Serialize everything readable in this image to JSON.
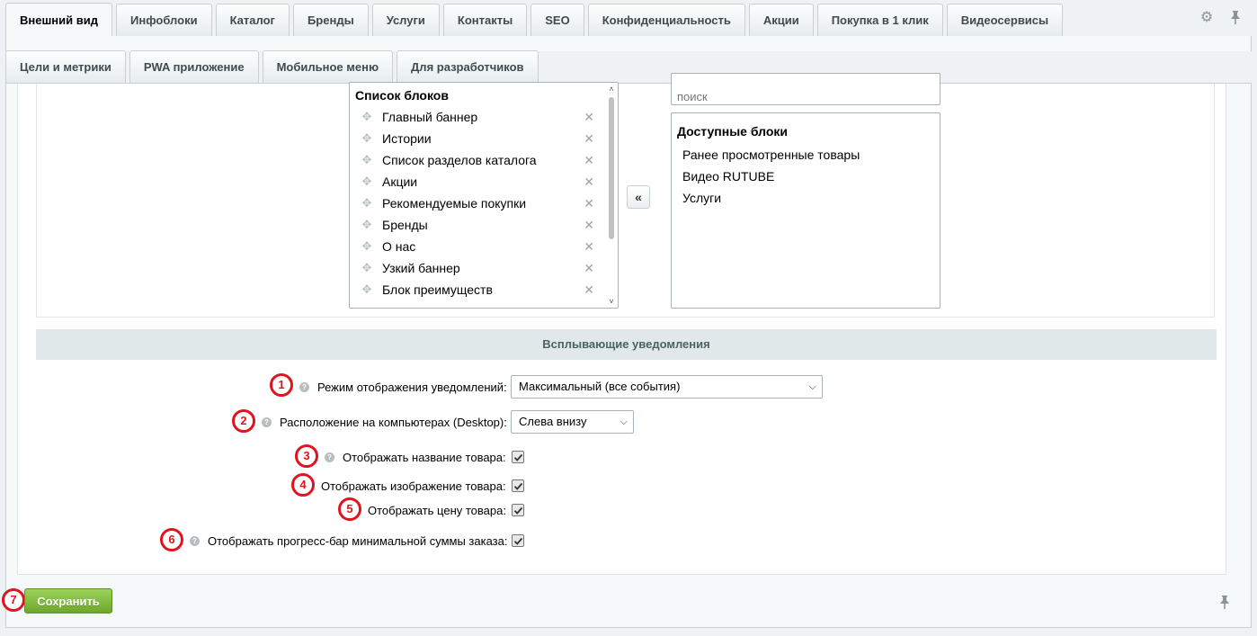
{
  "tabs_row1": [
    "Внешний вид",
    "Инфоблоки",
    "Каталог",
    "Бренды",
    "Услуги",
    "Контакты",
    "SEO",
    "Конфиденциальность",
    "Акции",
    "Покупка в 1 клик",
    "Видеосервисы"
  ],
  "tabs_row2": [
    "Цели и метрики",
    "PWA приложение",
    "Мобильное меню",
    "Для разработчиков"
  ],
  "active_tab": "Внешний вид",
  "icons": {
    "settings": "gear-icon",
    "pin": "pin-icon",
    "drag": "drag-move-icon",
    "remove": "close-icon",
    "move_left": "double-chevron-left-icon"
  },
  "blocks": {
    "list_title": "Список блоков",
    "list": [
      "Главный баннер",
      "Истории",
      "Список разделов каталога",
      "Акции",
      "Рекомендуемые покупки",
      "Бренды",
      "О нас",
      "Узкий баннер",
      "Блок преимуществ"
    ],
    "search_placeholder": "поиск",
    "available_title": "Доступные блоки",
    "available": [
      "Ранее просмотренные товары",
      "Видео RUTUBE",
      "Услуги"
    ],
    "move_label": "«"
  },
  "notifications": {
    "header": "Всплывающие уведомления",
    "mode_label": "Режим отображения уведомлений:",
    "mode_value": "Максимальный (все события)",
    "position_label": "Расположение на компьютерах (Desktop):",
    "position_value": "Слева внизу",
    "show_name_label": "Отображать название товара:",
    "show_name": true,
    "show_image_label": "Отображать изображение товара:",
    "show_image": true,
    "show_price_label": "Отображать цену товара:",
    "show_price": true,
    "show_progress_label": "Отображать прогресс-бар минимальной суммы заказа:",
    "show_progress": true
  },
  "markers": [
    "1",
    "2",
    "3",
    "4",
    "5",
    "6",
    "7"
  ],
  "marker_color": "#e0141e",
  "save_label": "Сохранить",
  "save_color": "#7cb83a"
}
